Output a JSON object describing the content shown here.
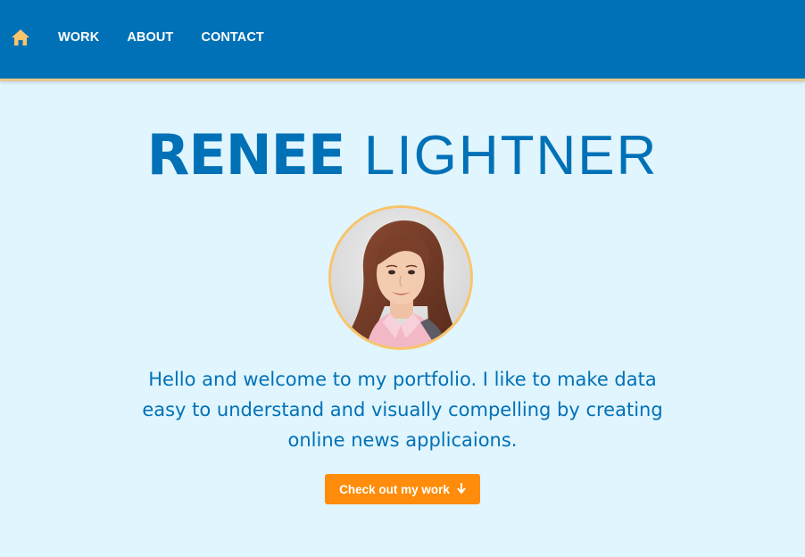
{
  "nav": {
    "home_icon": "home-icon",
    "links": [
      {
        "label": "WORK"
      },
      {
        "label": "ABOUT"
      },
      {
        "label": "CONTACT"
      }
    ]
  },
  "hero": {
    "first_name": "RENEE",
    "last_name": "LIGHTNER",
    "avatar_icon": "profile-photo",
    "welcome_text": "Hello and welcome to my portfolio. I like to make data easy to understand and visually compelling by creating online news applicaions.",
    "cta_label": "Check out my work",
    "cta_icon": "arrow-down-icon"
  },
  "colors": {
    "nav_bg": "#0071b7",
    "page_bg": "#e0f5fd",
    "accent_orange": "#ff8c0a",
    "home_icon": "#f9c46b",
    "text_blue": "#0071b7"
  }
}
